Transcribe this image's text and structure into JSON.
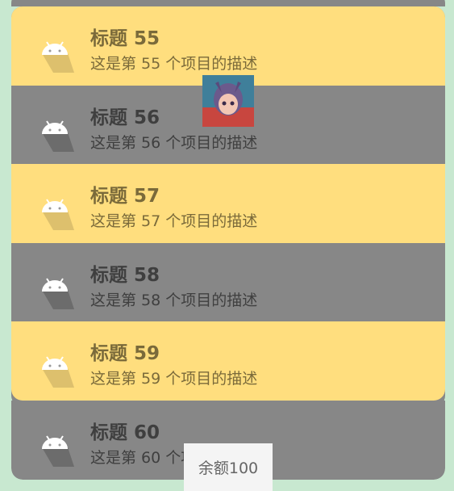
{
  "items": [
    {
      "title": "标题 55",
      "desc": "这是第 55 个项目的描述"
    },
    {
      "title": "标题 56",
      "desc": "这是第 56 个项目的描述"
    },
    {
      "title": "标题 57",
      "desc": "这是第 57 个项目的描述"
    },
    {
      "title": "标题 58",
      "desc": "这是第 58 个项目的描述"
    },
    {
      "title": "标题 59",
      "desc": "这是第 59 个项目的描述"
    },
    {
      "title": "标题 60",
      "desc": "这是第 60 个项目的描述"
    }
  ],
  "icons": {
    "item": "android-icon",
    "avatar": "avatar-image"
  },
  "toast": {
    "text": "余额100"
  },
  "colors": {
    "yellow_row": "#ffde7e",
    "gray_row": "#878787",
    "background": "#c8e8d0"
  }
}
